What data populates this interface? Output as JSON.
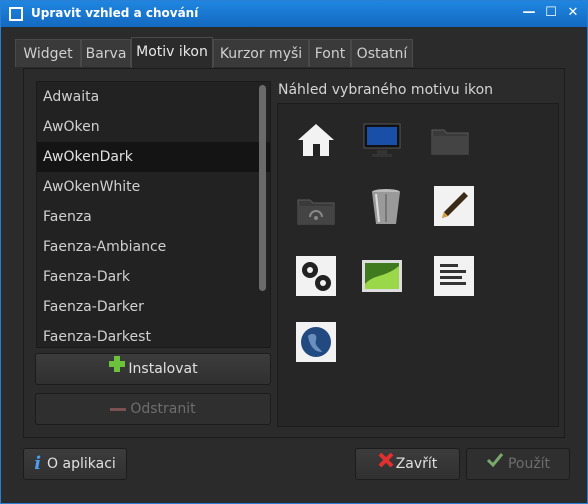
{
  "window": {
    "title": "Upravit vzhled a chování",
    "controls": [
      "minimize-icon",
      "maximize-icon",
      "close-icon"
    ]
  },
  "tabs": [
    {
      "label": "Widget"
    },
    {
      "label": "Barva"
    },
    {
      "label": "Motiv ikon",
      "active": true
    },
    {
      "label": "Kurzor myši"
    },
    {
      "label": "Font"
    },
    {
      "label": "Ostatní"
    }
  ],
  "theme_list": {
    "items": [
      "Adwaita",
      "AwOken",
      "AwOkenDark",
      "AwOkenWhite",
      "Faenza",
      "Faenza-Ambiance",
      "Faenza-Dark",
      "Faenza-Darker",
      "Faenza-Darkest"
    ],
    "selected": "AwOkenDark"
  },
  "buttons": {
    "install": "Instalovat",
    "remove": "Odstranit",
    "about": "O aplikaci",
    "close": "Zavřít",
    "apply": "Použít"
  },
  "preview": {
    "title": "Náhled vybraného motivu ikon",
    "icons": [
      "home-icon",
      "monitor-icon",
      "folder-icon",
      "network-folder-icon",
      "trash-icon",
      "pen-icon",
      "settings-gears-icon",
      "image-icon",
      "text-document-icon",
      "globe-icon"
    ]
  },
  "colors": {
    "titlebar": "#1a78d4",
    "install_plus": "#6cc23a",
    "close_x": "#e03030",
    "apply_check": "#7aa86a"
  }
}
